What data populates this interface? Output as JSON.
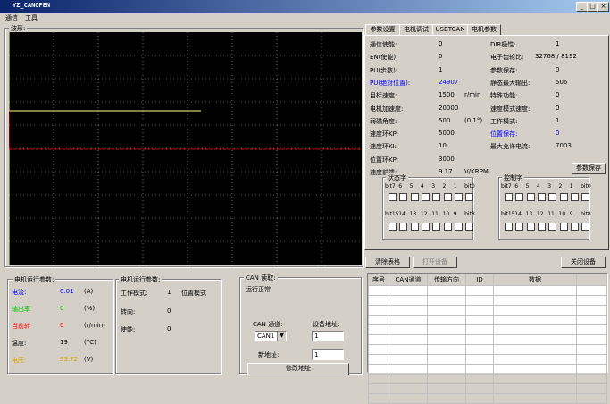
{
  "window": {
    "title": "YZ_CANOPEN",
    "min": "_",
    "max": "□",
    "close": "×"
  },
  "menu": [
    "通信",
    "工具"
  ],
  "waveform": {
    "label": "波形:"
  },
  "tabs": [
    "参数设置",
    "电机调试",
    "USBTCAN",
    "电机参数"
  ],
  "params_left": [
    {
      "label": "通信使能:",
      "value": "0",
      "unit": ""
    },
    {
      "label": "EN(使能):",
      "value": "0",
      "unit": ""
    },
    {
      "label": "PU(步数):",
      "value": "1",
      "unit": ""
    },
    {
      "label": "PU(绝对位置):",
      "value": "24907",
      "unit": "",
      "highlight": true
    },
    {
      "label": "目标速度:",
      "value": "1500",
      "unit": "r/min"
    },
    {
      "label": "电机加速度:",
      "value": "20000",
      "unit": ""
    },
    {
      "label": "弱磁角度:",
      "value": "500",
      "unit": "(0.1°)"
    },
    {
      "label": "速度环KP:",
      "value": "5000",
      "unit": ""
    },
    {
      "label": "速度环KI:",
      "value": "10",
      "unit": ""
    },
    {
      "label": "位置环KP:",
      "value": "3000",
      "unit": ""
    },
    {
      "label": "速度前馈:",
      "value": "9.17",
      "unit": "V/KRPM"
    }
  ],
  "params_right": [
    {
      "label": "DIR极性:",
      "value": "1"
    },
    {
      "label": "电子齿轮比:",
      "value": "32768   /   8192"
    },
    {
      "label": "参数保存:",
      "value": "0"
    },
    {
      "label": "静态最大输出:",
      "value": "506"
    },
    {
      "label": "特殊功能:",
      "value": "0"
    },
    {
      "label": "速度模式速度:",
      "value": "0"
    },
    {
      "label": "工作模式:",
      "value": "1"
    },
    {
      "label": "位置保存:",
      "value": "0",
      "highlight": true
    },
    {
      "label": "最大允许电流:",
      "value": "7003"
    }
  ],
  "param_save_button": "参数保存",
  "status_word": {
    "label": "状态字",
    "row1": [
      "bit7",
      "6",
      "5",
      "4",
      "3",
      "2",
      "1",
      "bit0"
    ],
    "row2": [
      "bit15",
      "14",
      "13",
      "12",
      "11",
      "10",
      "9",
      "bit8"
    ]
  },
  "control_word": {
    "label": "控制字",
    "row1": [
      "bit7",
      "6",
      "5",
      "4",
      "3",
      "2",
      "1",
      "bit0"
    ],
    "row2": [
      "bit15",
      "14",
      "13",
      "12",
      "11",
      "10",
      "9",
      "bit8"
    ]
  },
  "buttons": {
    "clear_table": "清除表格",
    "open_device": "打开设备",
    "close_device": "关闭设备",
    "modify_address": "修改地址"
  },
  "table_headers": [
    "序号",
    "CAN通道",
    "传输方向",
    "ID",
    "数据"
  ],
  "motor_params1": {
    "label": "电机运行参数:",
    "rows": [
      {
        "label": "电流:",
        "value": "0.01",
        "unit": "(A)",
        "color": "#0000ff"
      },
      {
        "label": "输出率",
        "value": "0",
        "unit": "(%)",
        "color": "#00c000"
      },
      {
        "label": "当前转",
        "value": "0",
        "unit": "(r/min)",
        "color": "#ff0000"
      },
      {
        "label": "温度:",
        "value": "19",
        "unit": "(°C)",
        "color": "#000000"
      },
      {
        "label": "电压:",
        "value": "33.72",
        "unit": "(V)",
        "color": "#d4a000"
      }
    ]
  },
  "motor_params2": {
    "label": "电机运行参数:",
    "rows": [
      {
        "label": "工作模式:",
        "value": "1",
        "extra": "位置模式"
      },
      {
        "label": "转向:",
        "value": "0",
        "extra": ""
      },
      {
        "label": "使能:",
        "value": "0",
        "extra": ""
      }
    ]
  },
  "can_read": {
    "label": "CAN 读取:",
    "status": "运行正常",
    "channel_label": "CAN 通道:",
    "channel_value": "CAN1",
    "device_addr_label": "设备地址:",
    "device_addr_value": "1",
    "new_addr_label": "新地址:",
    "new_addr_value": "1"
  },
  "colors": {
    "scope_bg": "#000000",
    "grid": "#c0c0c0",
    "trace_red": "#ff0000",
    "trace_yellow": "#ffff80"
  }
}
